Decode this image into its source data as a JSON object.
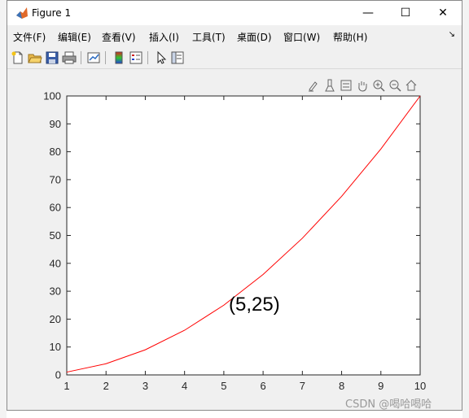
{
  "window": {
    "title": "Figure 1",
    "minimize": "—",
    "maximize": "☐",
    "close": "✕"
  },
  "menubar": {
    "items": [
      "文件(F)",
      "编辑(E)",
      "查看(V)",
      "插入(I)",
      "工具(T)",
      "桌面(D)",
      "窗口(W)",
      "帮助(H)"
    ]
  },
  "toolbar": {
    "icons": [
      "new-figure-icon",
      "open-icon",
      "save-icon",
      "print-icon",
      "link-plot-icon",
      "colorbar-icon",
      "legend-icon",
      "edit-plot-icon",
      "property-inspector-icon"
    ]
  },
  "axes_toolbar": {
    "icons": [
      "brush-icon",
      "data-tips-icon",
      "zoom-in-icon",
      "pan-icon",
      "zoom-out-icon",
      "restore-view-icon"
    ]
  },
  "annotation": {
    "text": "(5,25)"
  },
  "watermark": {
    "text": "CSDN @喝哈喝哈"
  },
  "colors": {
    "line": "#ff0000",
    "axes_bg": "#ffffff",
    "figure_bg": "#f0f0f0"
  },
  "chart_data": {
    "type": "line",
    "x": [
      1,
      2,
      3,
      4,
      5,
      6,
      7,
      8,
      9,
      10
    ],
    "series": [
      {
        "values": [
          1,
          4,
          9,
          16,
          25,
          36,
          49,
          64,
          81,
          100
        ],
        "color": "#ff0000"
      }
    ],
    "xlim": [
      1,
      10
    ],
    "ylim": [
      0,
      100
    ],
    "xticks": [
      1,
      2,
      3,
      4,
      5,
      6,
      7,
      8,
      9,
      10
    ],
    "yticks": [
      0,
      10,
      20,
      30,
      40,
      50,
      60,
      70,
      80,
      90,
      100
    ],
    "grid": false,
    "title": "",
    "xlabel": "",
    "ylabel": ""
  }
}
